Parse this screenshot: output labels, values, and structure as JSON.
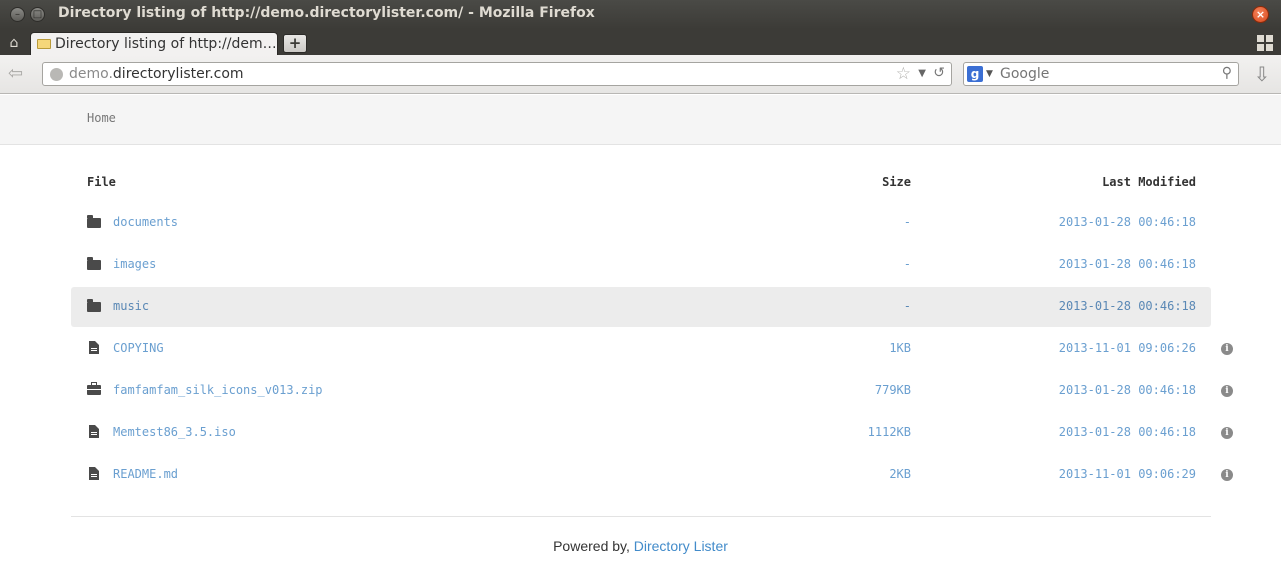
{
  "window": {
    "title": "Directory listing of http://demo.directorylister.com/ - Mozilla Firefox",
    "minimize_glyph": "–",
    "maximize_glyph": "□",
    "close_glyph": "×"
  },
  "tabs": {
    "active_label": "Directory listing of http://dem…",
    "new_tab_glyph": "+"
  },
  "navbar": {
    "url_dim": "demo.",
    "url_main": "directorylister.com",
    "search_engine": "g",
    "search_placeholder": "Google"
  },
  "breadcrumb": {
    "home": "Home"
  },
  "table": {
    "headers": {
      "file": "File",
      "size": "Size",
      "modified": "Last Modified"
    },
    "rows": [
      {
        "icon": "folder-icon",
        "name": "documents",
        "size": "-",
        "modified": "2013-01-28 00:46:18",
        "info": false
      },
      {
        "icon": "folder-icon",
        "name": "images",
        "size": "-",
        "modified": "2013-01-28 00:46:18",
        "info": false
      },
      {
        "icon": "folder-icon",
        "name": "music",
        "size": "-",
        "modified": "2013-01-28 00:46:18",
        "info": false,
        "highlighted": true
      },
      {
        "icon": "file-icon",
        "name": "COPYING",
        "size": "1KB",
        "modified": "2013-11-01 09:06:26",
        "info": true
      },
      {
        "icon": "briefcase-icon",
        "name": "famfamfam_silk_icons_v013.zip",
        "size": "779KB",
        "modified": "2013-01-28 00:46:18",
        "info": true
      },
      {
        "icon": "file-icon",
        "name": "Memtest86_3.5.iso",
        "size": "1112KB",
        "modified": "2013-01-28 00:46:18",
        "info": true
      },
      {
        "icon": "file-icon",
        "name": "README.md",
        "size": "2KB",
        "modified": "2013-11-01 09:06:29",
        "info": true
      }
    ]
  },
  "footer": {
    "prefix": "Powered by,",
    "link": "Directory Lister"
  },
  "colors": {
    "link": "#6a9fd0",
    "footer_link": "#428bca",
    "highlight_row": "#ececec"
  }
}
